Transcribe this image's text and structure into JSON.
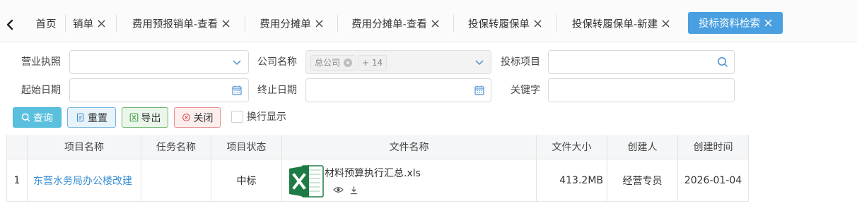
{
  "tabs": [
    {
      "label": "首页",
      "closable": false,
      "active": false
    },
    {
      "label": "销单",
      "closable": true,
      "active": false
    },
    {
      "label": "费用预报销单-查看",
      "closable": true,
      "active": false
    },
    {
      "label": "费用分摊单",
      "closable": true,
      "active": false
    },
    {
      "label": "费用分摊单-查看",
      "closable": true,
      "active": false
    },
    {
      "label": "投保转履保单",
      "closable": true,
      "active": false
    },
    {
      "label": "投保转履保单-新建",
      "closable": true,
      "active": false
    },
    {
      "label": "投标资料检索",
      "closable": true,
      "active": true
    }
  ],
  "filters": {
    "license_label": "营业执照",
    "license_value": "",
    "company_label": "公司名称",
    "company_chip": "总公司",
    "company_more": "+ 14",
    "project_label": "投标项目",
    "project_value": "",
    "start_label": "起始日期",
    "start_value": "",
    "end_label": "终止日期",
    "end_value": "",
    "keyword_label": "关键字",
    "keyword_value": ""
  },
  "toolbar": {
    "query": "查询",
    "reset": "重置",
    "export": "导出",
    "close": "关闭",
    "wrap_label": "换行显示"
  },
  "grid": {
    "columns": [
      "",
      "项目名称",
      "任务名称",
      "项目状态",
      "文件名称",
      "文件大小",
      "创建人",
      "创建时间"
    ],
    "rows": [
      {
        "index": "1",
        "project": "东营水务局办公楼改建",
        "task": "",
        "status": "中标",
        "file_name": "材料预算执行汇总.xls",
        "file_size": "413.2MB",
        "creator": "经营专员",
        "created": "2026-01-04"
      }
    ]
  },
  "colors": {
    "active_tab": "#4a9fe0",
    "query_button": "#5bc0de",
    "link": "#3b8fd4",
    "excel_green": "#1e7b45"
  },
  "icons": {
    "back": "chevron-left-icon",
    "tab_close": "close-icon",
    "dropdown": "chevron-down-icon",
    "search": "search-icon",
    "calendar": "calendar-icon",
    "file": "excel-file-icon",
    "preview": "eye-icon",
    "download": "download-icon"
  }
}
